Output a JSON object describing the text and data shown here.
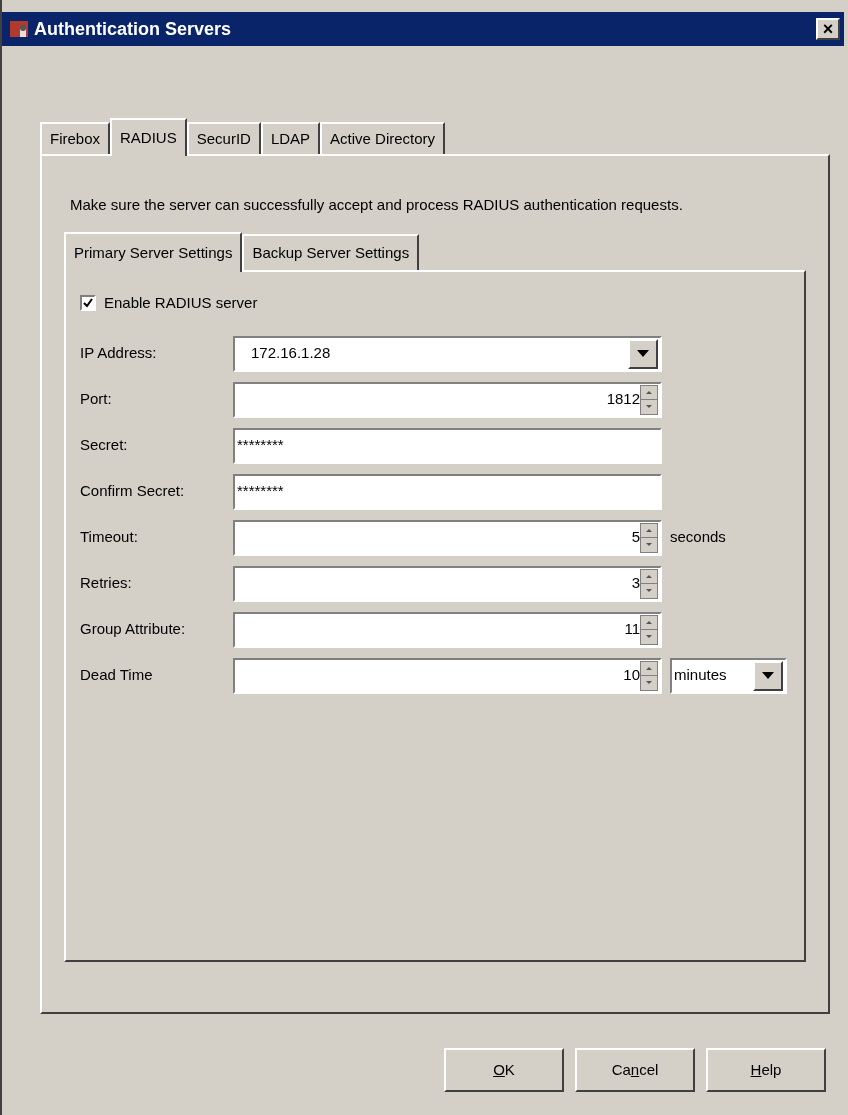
{
  "window": {
    "title": "Authentication Servers",
    "close_label": "×"
  },
  "tabs": [
    {
      "label": "Firebox",
      "selected": false
    },
    {
      "label": "RADIUS",
      "selected": true
    },
    {
      "label": "SecurID",
      "selected": false
    },
    {
      "label": "LDAP",
      "selected": false
    },
    {
      "label": "Active Directory",
      "selected": false
    }
  ],
  "description": "Make sure the server can successfully accept and process RADIUS authentication requests.",
  "server_tabs": [
    {
      "label": "Primary Server Settings",
      "selected": true
    },
    {
      "label": "Backup Server Settings",
      "selected": false
    }
  ],
  "enable_checkbox": {
    "label": "Enable RADIUS server",
    "checked": true
  },
  "fields": [
    {
      "label": "IP Address:",
      "kind": "dropdown",
      "value": "172.16.1.28"
    },
    {
      "label": "Port:",
      "kind": "spinner",
      "value": "1812"
    },
    {
      "label": "Secret:",
      "kind": "text",
      "value": "********"
    },
    {
      "label": "Confirm Secret:",
      "kind": "text",
      "value": "********"
    },
    {
      "label": "Timeout:",
      "kind": "spinner",
      "value": "5",
      "suffix": "seconds"
    },
    {
      "label": "Retries:",
      "kind": "spinner",
      "value": "3"
    },
    {
      "label": "Group Attribute:",
      "kind": "spinner",
      "value": "11"
    },
    {
      "label": "Dead Time",
      "kind": "spinner",
      "value": "10",
      "unit_select": "minutes"
    }
  ],
  "buttons": [
    {
      "accel": "O",
      "after": "K"
    },
    {
      "before": "Ca",
      "accel": "n",
      "after": "cel"
    },
    {
      "accel": "H",
      "after": "elp"
    }
  ]
}
